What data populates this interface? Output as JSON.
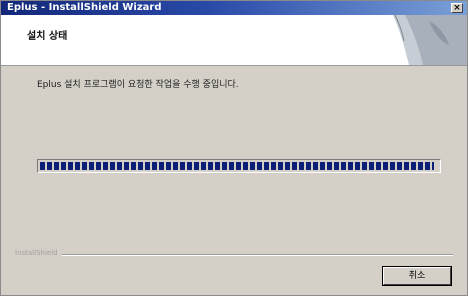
{
  "window": {
    "title": "Eplus - InstallShield Wizard",
    "close_glyph": "×"
  },
  "header": {
    "title": "설치 상태"
  },
  "main": {
    "message": "Eplus 설치 프로그램이 요청한 작업을 수행 중입니다.",
    "progress_fraction": 0.99
  },
  "footer": {
    "brand": "InstallShield",
    "cancel_label": "취소"
  }
}
